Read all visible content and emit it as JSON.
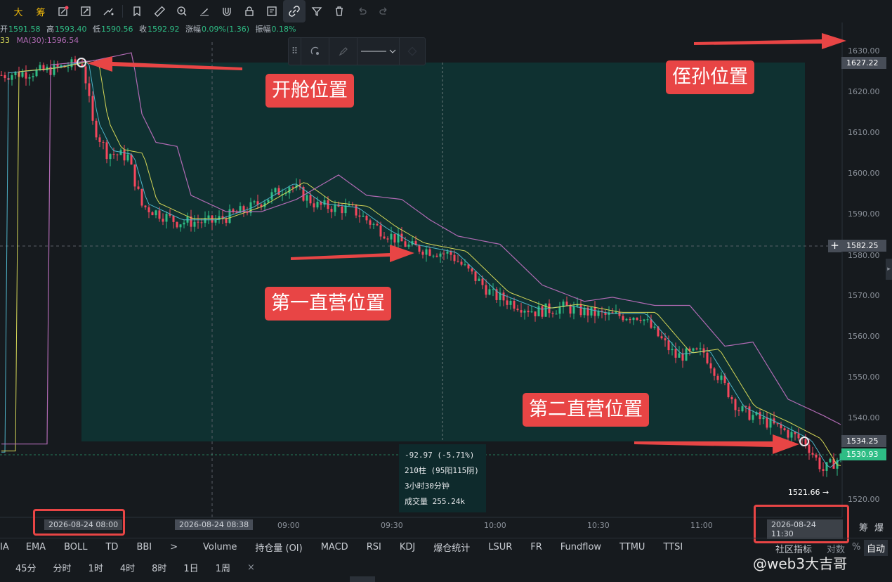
{
  "toolbar": {
    "items": [
      "大",
      "筹",
      "pencil-alert-icon",
      "edit-box-icon",
      "line-tools-icon",
      "bookmark-icon",
      "ruler-icon",
      "zoom-icon",
      "brush-icon",
      "magnet-icon",
      "lock-icon",
      "draw-list-icon",
      "link-icon",
      "filter-icon",
      "trash-icon",
      "undo-icon",
      "redo-icon"
    ]
  },
  "ohlc": {
    "open_label": "开",
    "open": "1591.58",
    "high_label": "高",
    "high": "1593.40",
    "low_label": "低",
    "low": "1590.56",
    "close_label": "收",
    "close": "1592.92",
    "change_label": "涨幅",
    "change": "0.09%(1.36)",
    "amp_label": "振幅",
    "amp": "0.18%"
  },
  "ma": {
    "ma_fragment": "33",
    "ma30": "MA(30):1596.54"
  },
  "annotations": {
    "open_pos": "开舱位置",
    "stop_pos": "侄孙位置",
    "first_tp": "第一直营位置",
    "second_tp": "第二直营位置"
  },
  "measure": {
    "change": "-92.97 (-5.71%)",
    "bars": "210柱 (95阳115阴)",
    "duration": "3小时30分钟",
    "volume": "成交量 255.24k"
  },
  "low_marker": "1521.66 →",
  "price_axis": {
    "labels": [
      "1630.00",
      "1620.00",
      "1610.00",
      "1600.00",
      "1590.00",
      "1580.00",
      "1570.00",
      "1560.00",
      "1550.00",
      "1540.00",
      "1520.00"
    ],
    "tag_top": "1627.22",
    "tag_cross": "1582.25",
    "tag_bottom": "1534.25",
    "tag_last": "1530.93"
  },
  "time_axis": {
    "start": "2026-08-24 08:00",
    "cursor": "2026-08-24 08:38",
    "t0900": "09:00",
    "t0930": "09:30",
    "t1000": "10:00",
    "t1030": "10:30",
    "t1100": "11:00",
    "end": "2026-08-24 11:30",
    "right_a": "筹",
    "right_b": "爆"
  },
  "indicators": {
    "items": [
      "IA",
      "EMA",
      "BOLL",
      "TD",
      "BBI",
      ">",
      "Volume",
      "持仓量 (OI)",
      "MACD",
      "RSI",
      "KDJ",
      "爆仓统计",
      "LSUR",
      "FR",
      "Fundflow",
      "TTMU",
      "TTSI"
    ],
    "community": "社区指标",
    "log": "对数",
    "pct": "%",
    "auto": "自动"
  },
  "timeframes": [
    "45分",
    "分时",
    "1时",
    "4时",
    "8时",
    "1日",
    "1周",
    "×"
  ],
  "watermark": "@web3大吉哥",
  "colors": {
    "up": "#2ebd85",
    "down": "#f6465d",
    "ma_short": "#4fb3c9",
    "ma_mid": "#d4d657",
    "ma30": "#b06ab3",
    "zone": "#0f3333",
    "annotation": "#e84545"
  }
}
